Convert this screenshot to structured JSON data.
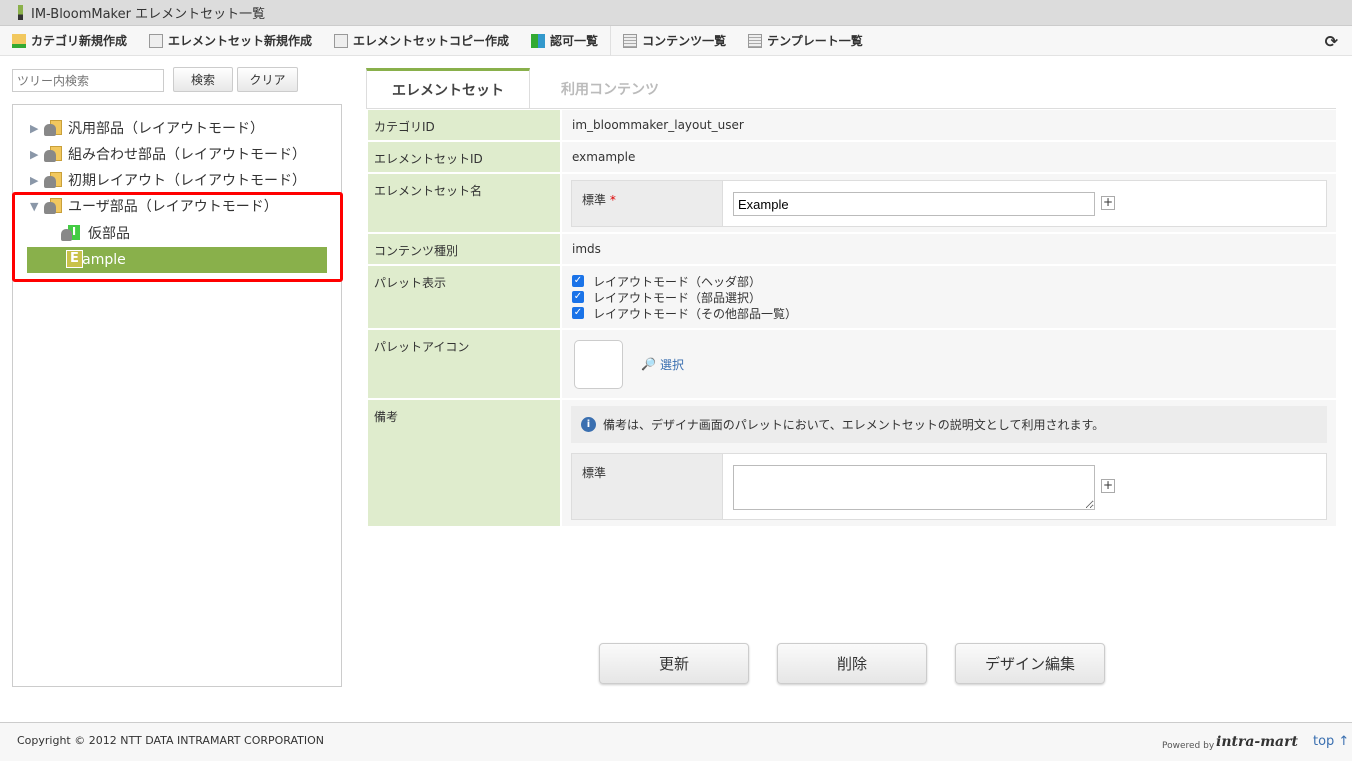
{
  "window": {
    "title": "IM-BloomMaker エレメントセット一覧"
  },
  "toolbar": {
    "items": [
      "カテゴリ新規作成",
      "エレメントセット新規作成",
      "エレメントセットコピー作成",
      "認可一覧",
      "コンテンツ一覧",
      "テンプレート一覧"
    ]
  },
  "search": {
    "placeholder": "ツリー内検索",
    "search_label": "検索",
    "clear_label": "クリア"
  },
  "tree": {
    "nodes": [
      "汎用部品（レイアウトモード）",
      "組み合わせ部品（レイアウトモード）",
      "初期レイアウト（レイアウトモード）",
      "ユーザ部品（レイアウトモード）"
    ],
    "child": "仮部品",
    "child_badge": "I",
    "selected": "Example",
    "selected_badge": "E"
  },
  "tabs": [
    "エレメントセット",
    "利用コンテンツ"
  ],
  "form": {
    "category_id_label": "カテゴリID",
    "category_id": "im_bloommaker_layout_user",
    "set_id_label": "エレメントセットID",
    "set_id": "exmample",
    "set_name_label": "エレメントセット名",
    "locale_label": "標準",
    "required_mark": "*",
    "set_name": "Example",
    "content_type_label": "コンテンツ種別",
    "content_type": "imds",
    "palette_label": "パレット表示",
    "palette_options": [
      "レイアウトモード（ヘッダ部）",
      "レイアウトモード（部品選択）",
      "レイアウトモード（その他部品一覧）"
    ],
    "icon_label": "パレットアイコン",
    "select_label": "選択",
    "note_label": "備考",
    "note_info": "備考は、デザイナ画面のパレットにおいて、エレメントセットの説明文として利用されます。",
    "note_locale": "標準",
    "note_value": ""
  },
  "buttons": {
    "update": "更新",
    "delete": "削除",
    "design": "デザイン編集"
  },
  "footer": {
    "copyright": "Copyright © 2012 NTT DATA INTRAMART CORPORATION",
    "powered": "Powered by",
    "logo": "intra-mart",
    "top": "top ↑"
  },
  "colors": {
    "accent": "#89b04b",
    "label_bg": "#dfeccd",
    "highlight": "#ff0000"
  }
}
